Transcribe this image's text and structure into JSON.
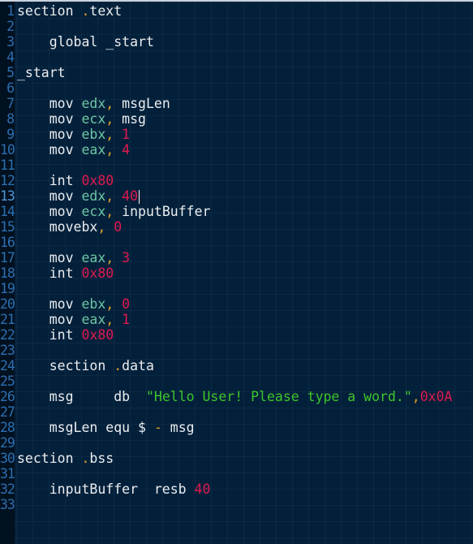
{
  "editor": {
    "language": "nasm-assembly",
    "cursor": {
      "line": 13,
      "column": 16
    },
    "colors": {
      "background": "#03203b",
      "gutter": "#02111f",
      "line_number": "#2c6fb3",
      "text": "#ebeef0",
      "register": "#6dc7a3",
      "punctuation": "#e0a02a",
      "number": "#e0194f",
      "string": "#3ec62a"
    },
    "lines": [
      {
        "n": "1",
        "tokens": [
          {
            "t": "section ",
            "c": "kw"
          },
          {
            "t": ".",
            "c": "punc"
          },
          {
            "t": "text",
            "c": "kw"
          }
        ]
      },
      {
        "n": "2",
        "tokens": []
      },
      {
        "n": "3",
        "tokens": [
          {
            "t": "    global _start",
            "c": "kw"
          }
        ]
      },
      {
        "n": "4",
        "tokens": []
      },
      {
        "n": "5",
        "tokens": [
          {
            "t": "_start",
            "c": "kw"
          }
        ]
      },
      {
        "n": "6",
        "tokens": []
      },
      {
        "n": "7",
        "tokens": [
          {
            "t": "    mov ",
            "c": "kw"
          },
          {
            "t": "edx",
            "c": "reg"
          },
          {
            "t": ",",
            "c": "punc"
          },
          {
            "t": " msgLen",
            "c": "kw"
          }
        ]
      },
      {
        "n": "8",
        "tokens": [
          {
            "t": "    mov ",
            "c": "kw"
          },
          {
            "t": "ecx",
            "c": "reg"
          },
          {
            "t": ",",
            "c": "punc"
          },
          {
            "t": " msg",
            "c": "kw"
          }
        ]
      },
      {
        "n": "9",
        "tokens": [
          {
            "t": "    mov ",
            "c": "kw"
          },
          {
            "t": "ebx",
            "c": "reg"
          },
          {
            "t": ",",
            "c": "punc"
          },
          {
            "t": " ",
            "c": "kw"
          },
          {
            "t": "1",
            "c": "num"
          }
        ]
      },
      {
        "n": "10",
        "tokens": [
          {
            "t": "    mov ",
            "c": "kw"
          },
          {
            "t": "eax",
            "c": "reg"
          },
          {
            "t": ",",
            "c": "punc"
          },
          {
            "t": " ",
            "c": "kw"
          },
          {
            "t": "4",
            "c": "num"
          }
        ]
      },
      {
        "n": "11",
        "tokens": []
      },
      {
        "n": "12",
        "tokens": [
          {
            "t": "    int ",
            "c": "kw"
          },
          {
            "t": "0x80",
            "c": "num"
          }
        ]
      },
      {
        "n": "13",
        "tokens": [
          {
            "t": "    mov ",
            "c": "kw"
          },
          {
            "t": "edx",
            "c": "reg"
          },
          {
            "t": ",",
            "c": "punc"
          },
          {
            "t": " ",
            "c": "kw"
          },
          {
            "t": "40",
            "c": "num"
          }
        ],
        "cursor": true
      },
      {
        "n": "14",
        "tokens": [
          {
            "t": "    mov ",
            "c": "kw"
          },
          {
            "t": "ecx",
            "c": "reg"
          },
          {
            "t": ",",
            "c": "punc"
          },
          {
            "t": " inputBuffer",
            "c": "kw"
          }
        ]
      },
      {
        "n": "15",
        "tokens": [
          {
            "t": "    movebx",
            "c": "kw"
          },
          {
            "t": ",",
            "c": "punc"
          },
          {
            "t": " ",
            "c": "kw"
          },
          {
            "t": "0",
            "c": "num"
          }
        ]
      },
      {
        "n": "16",
        "tokens": []
      },
      {
        "n": "17",
        "tokens": [
          {
            "t": "    mov ",
            "c": "kw"
          },
          {
            "t": "eax",
            "c": "reg"
          },
          {
            "t": ",",
            "c": "punc"
          },
          {
            "t": " ",
            "c": "kw"
          },
          {
            "t": "3",
            "c": "num"
          }
        ]
      },
      {
        "n": "18",
        "tokens": [
          {
            "t": "    int ",
            "c": "kw"
          },
          {
            "t": "0x80",
            "c": "num"
          }
        ]
      },
      {
        "n": "19",
        "tokens": []
      },
      {
        "n": "20",
        "tokens": [
          {
            "t": "    mov ",
            "c": "kw"
          },
          {
            "t": "ebx",
            "c": "reg"
          },
          {
            "t": ",",
            "c": "punc"
          },
          {
            "t": " ",
            "c": "kw"
          },
          {
            "t": "0",
            "c": "num"
          }
        ]
      },
      {
        "n": "21",
        "tokens": [
          {
            "t": "    mov ",
            "c": "kw"
          },
          {
            "t": "eax",
            "c": "reg"
          },
          {
            "t": ",",
            "c": "punc"
          },
          {
            "t": " ",
            "c": "kw"
          },
          {
            "t": "1",
            "c": "num"
          }
        ]
      },
      {
        "n": "22",
        "tokens": [
          {
            "t": "    int ",
            "c": "kw"
          },
          {
            "t": "0x80",
            "c": "num"
          }
        ]
      },
      {
        "n": "23",
        "tokens": []
      },
      {
        "n": "24",
        "tokens": [
          {
            "t": "    section ",
            "c": "kw"
          },
          {
            "t": ".",
            "c": "punc"
          },
          {
            "t": "data",
            "c": "kw"
          }
        ]
      },
      {
        "n": "25",
        "tokens": []
      },
      {
        "n": "26",
        "tokens": [
          {
            "t": "    msg     db  ",
            "c": "kw"
          },
          {
            "t": "\"Hello User! Please type a word.\"",
            "c": "str"
          },
          {
            "t": ",",
            "c": "punc"
          },
          {
            "t": "0x0A",
            "c": "num"
          }
        ]
      },
      {
        "n": "27",
        "tokens": []
      },
      {
        "n": "28",
        "tokens": [
          {
            "t": "    msgLen equ $ ",
            "c": "kw"
          },
          {
            "t": "-",
            "c": "op"
          },
          {
            "t": " msg",
            "c": "kw"
          }
        ]
      },
      {
        "n": "29",
        "tokens": []
      },
      {
        "n": "30",
        "tokens": [
          {
            "t": "section ",
            "c": "kw"
          },
          {
            "t": ".",
            "c": "punc"
          },
          {
            "t": "bss",
            "c": "kw"
          }
        ]
      },
      {
        "n": "31",
        "tokens": []
      },
      {
        "n": "32",
        "tokens": [
          {
            "t": "    inputBuffer  resb ",
            "c": "kw"
          },
          {
            "t": "40",
            "c": "num"
          }
        ]
      },
      {
        "n": "33",
        "tokens": []
      }
    ]
  }
}
